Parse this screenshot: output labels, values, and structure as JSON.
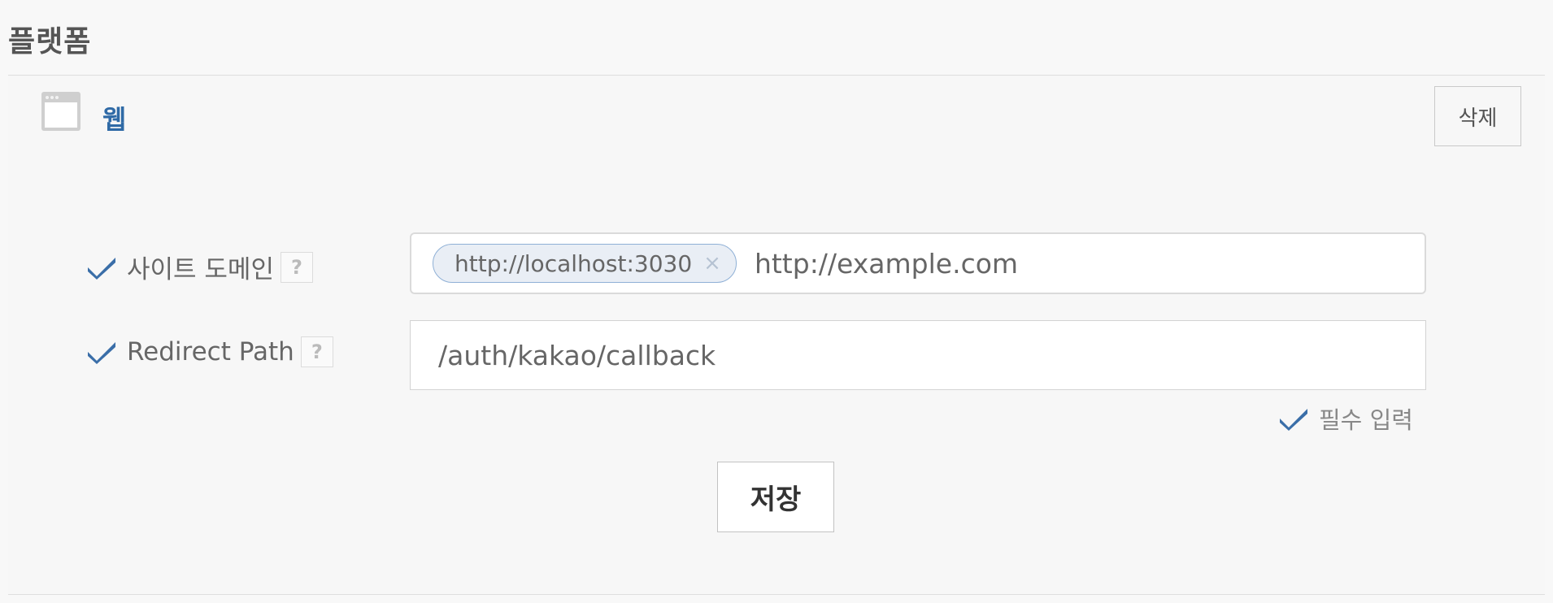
{
  "page": {
    "title": "플랫폼"
  },
  "platform": {
    "icon": "browser-window-icon",
    "name": "웹",
    "delete_label": "삭제"
  },
  "fields": {
    "site_domain": {
      "label": "사이트 도메인",
      "help": "?",
      "tags": [
        "http://localhost:3030"
      ],
      "tag_remove": "×",
      "value": "http://example.com"
    },
    "redirect_path": {
      "label": "Redirect Path",
      "help": "?",
      "value": "/auth/kakao/callback"
    }
  },
  "required_note": "필수 입력",
  "save_label": "저장",
  "colors": {
    "accent": "#2f6aa6",
    "check": "#3a6ea8"
  }
}
